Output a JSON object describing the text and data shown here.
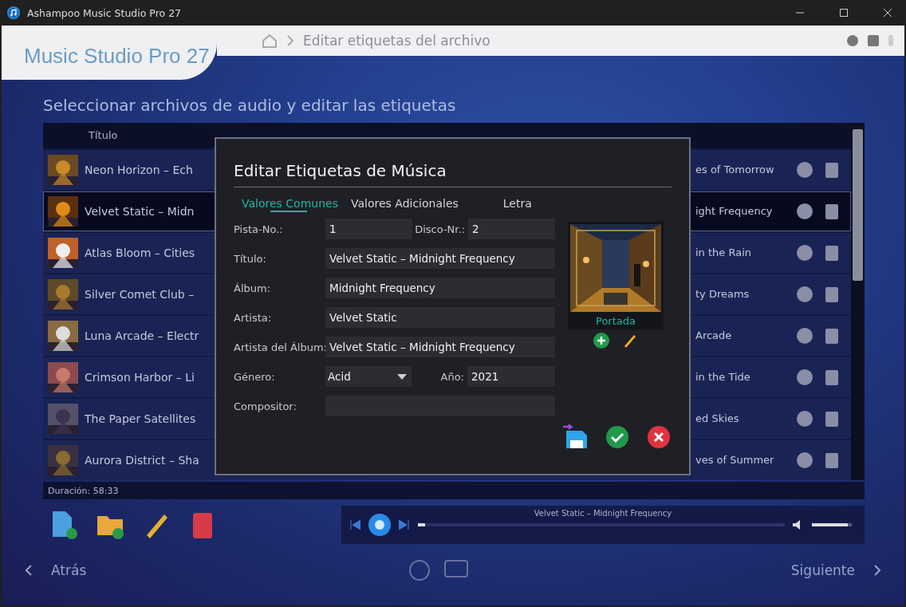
{
  "window": {
    "title": "Ashampoo Music Studio Pro 27"
  },
  "header": {
    "logo": "Music Studio Pro 27",
    "breadcrumb": "Editar etiquetas del archivo"
  },
  "page_heading": "Seleccionar archivos de audio y editar las etiquetas",
  "track_table": {
    "columns": [
      "Título"
    ],
    "rows": [
      {
        "title": "Neon Horizon – Ech",
        "album": "es of Tomorrow",
        "selected": false
      },
      {
        "title": "Velvet Static – Midn",
        "album": "ight Frequency",
        "selected": true
      },
      {
        "title": "Atlas Bloom – Cities",
        "album": "in the Rain",
        "selected": false
      },
      {
        "title": "Silver Comet Club –",
        "album": "ty Dreams",
        "selected": false
      },
      {
        "title": "Luna Arcade – Electr",
        "album": "Arcade",
        "selected": false
      },
      {
        "title": "Crimson Harbor – Li",
        "album": "in the Tide",
        "selected": false
      },
      {
        "title": "The Paper Satellites",
        "album": "ed Skies",
        "selected": false
      },
      {
        "title": "Aurora District – Sha",
        "album": "ves of Summer",
        "selected": false
      }
    ]
  },
  "status": "Duración: 58:33",
  "player": {
    "now_playing": "Velvet Static – Midnight Frequency",
    "progress": {
      "level": 0.02
    },
    "volume": {
      "level": 0.9
    }
  },
  "nav": {
    "back": "Atrás",
    "next": "Siguiente"
  },
  "dialog": {
    "title": "Editar Etiquetas de Música",
    "tabs": [
      {
        "label": "Valores Comunes",
        "selected": true
      },
      {
        "label": "Valores Adicionales",
        "selected": false
      },
      {
        "label": "Letra",
        "selected": false
      }
    ],
    "rows": [
      [
        {
          "label": "Pista-No.:",
          "value": "1",
          "kind": "text"
        },
        {
          "label": "Disco-Nr.:",
          "value": "2",
          "kind": "text"
        }
      ],
      [
        {
          "label": "Título:",
          "value": "Velvet Static – Midnight Frequency",
          "kind": "text"
        }
      ],
      [
        {
          "label": "Álbum:",
          "value": "Midnight Frequency",
          "kind": "text"
        }
      ],
      [
        {
          "label": "Artista:",
          "value": "Velvet Static",
          "kind": "text"
        }
      ],
      [
        {
          "label": "Artista del Álbum:",
          "value": "Velvet Static – Midnight Frequency",
          "kind": "text"
        }
      ],
      [
        {
          "label": "Género:",
          "value": "Acid",
          "kind": "select"
        },
        {
          "label": "Año:",
          "value": "2021",
          "kind": "text"
        }
      ],
      [
        {
          "label": "Compositor:",
          "kind": "text"
        }
      ]
    ],
    "cover": {
      "label": "Portada"
    }
  }
}
